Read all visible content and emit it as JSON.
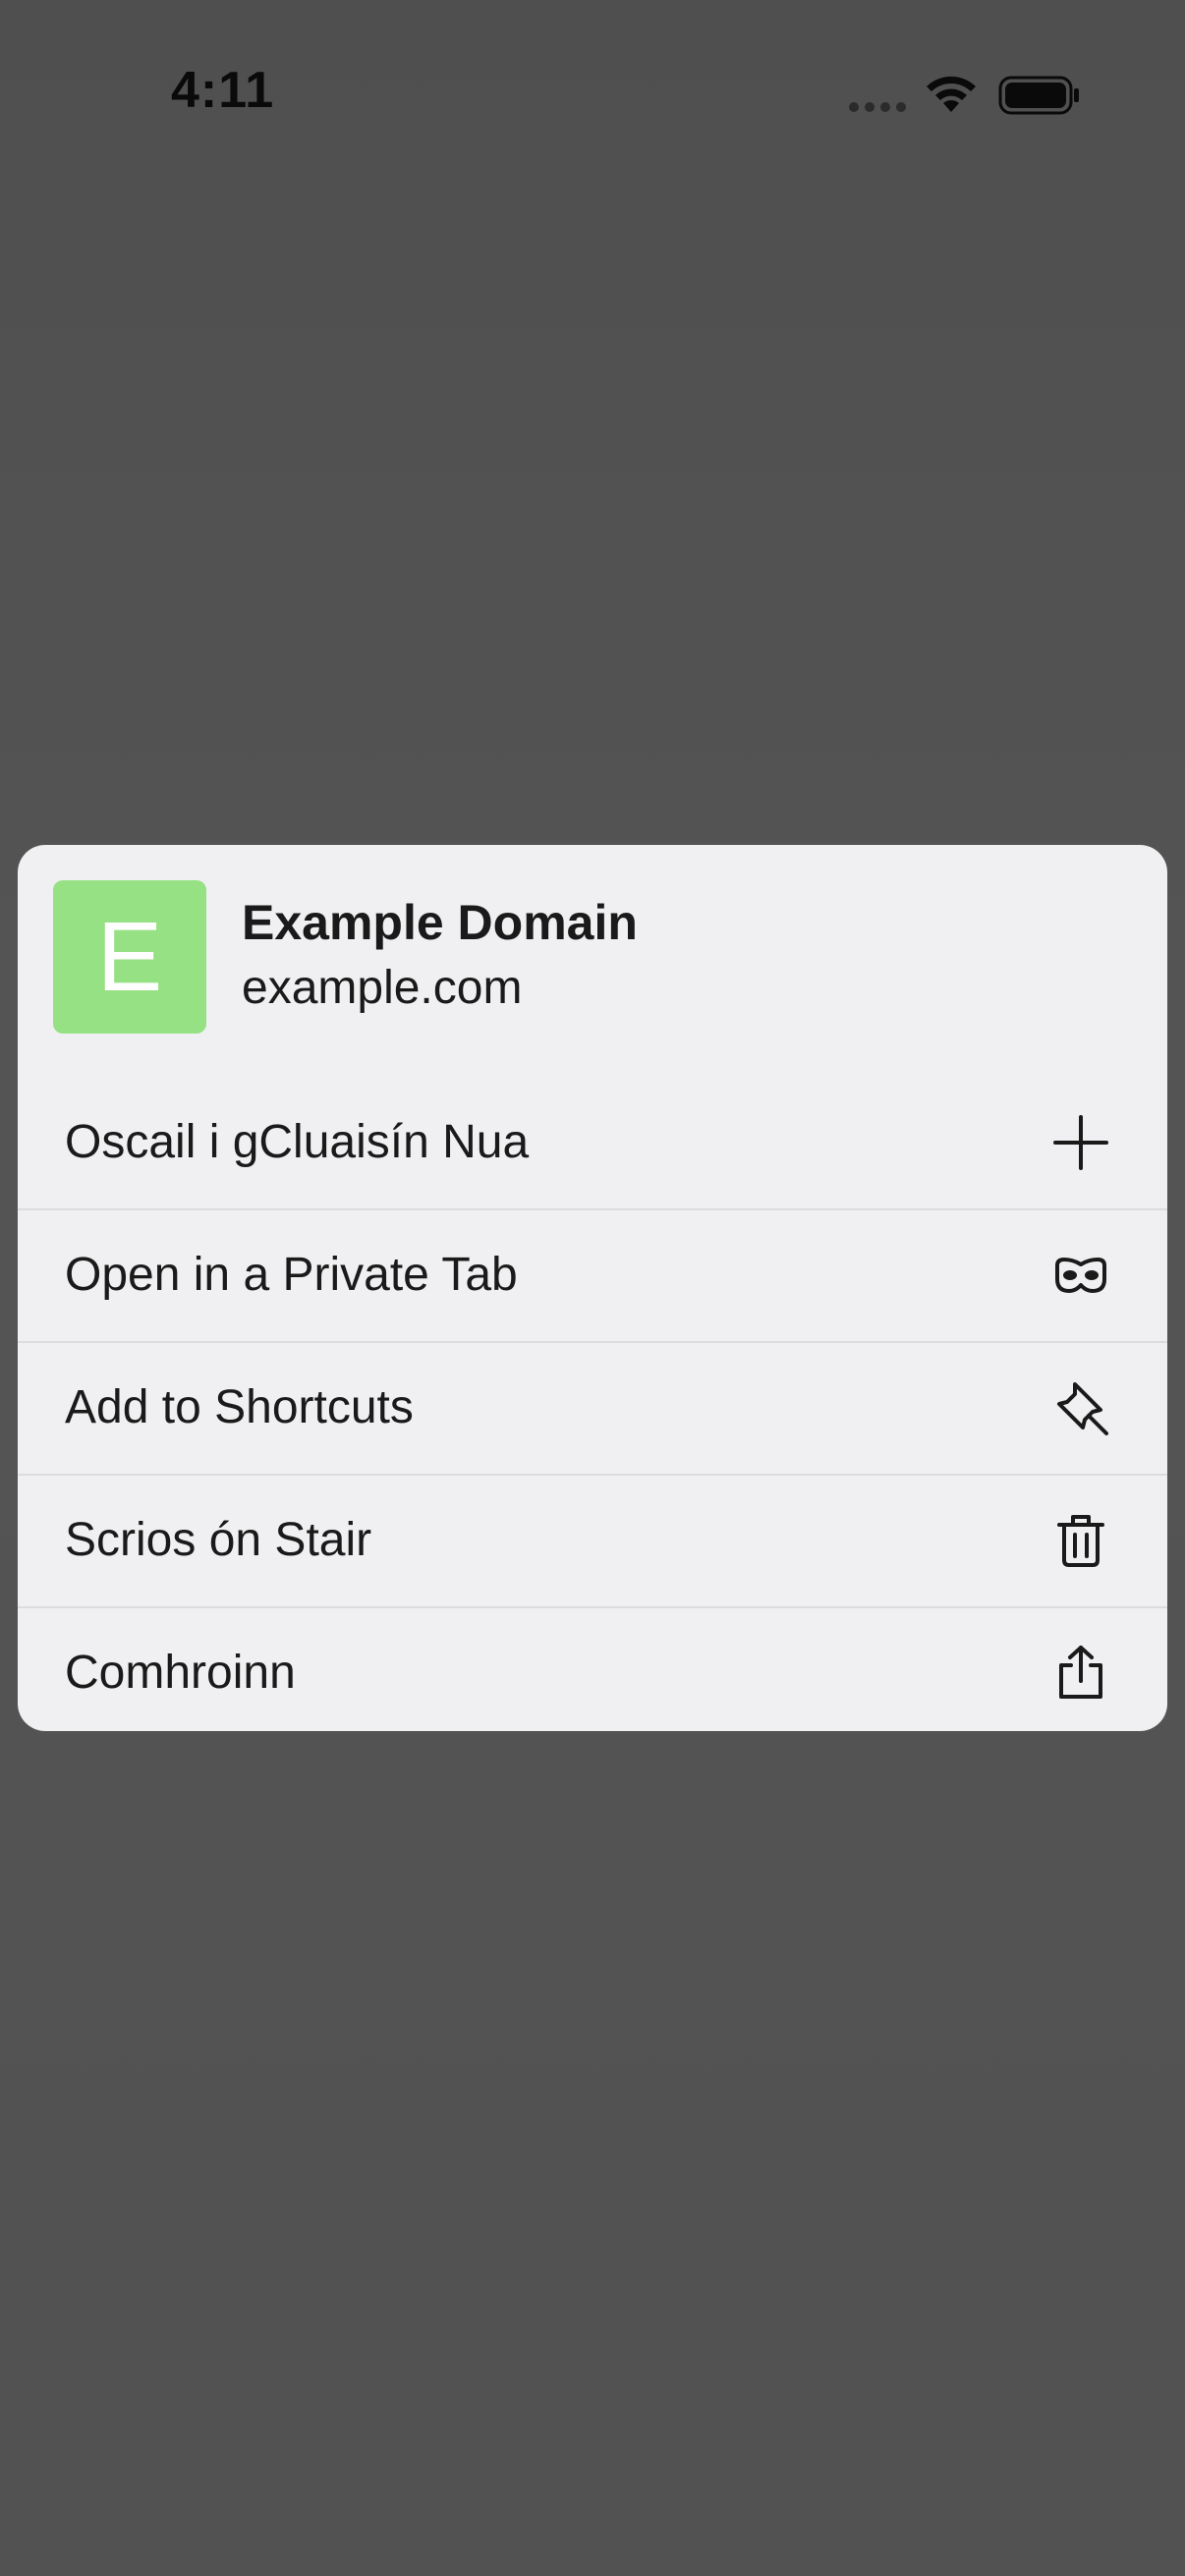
{
  "status_bar": {
    "time": "4:11",
    "icons": [
      "signal-dots-icon",
      "wifi-icon",
      "battery-icon"
    ]
  },
  "preview": {
    "favicon_letter": "E",
    "favicon_color": "#96e184",
    "title": "Example Domain",
    "url": "example.com"
  },
  "menu": {
    "items": [
      {
        "label": "Oscail i gCluaisín Nua",
        "icon": "plus-icon"
      },
      {
        "label": "Open in a Private Tab",
        "icon": "private-mask-icon"
      },
      {
        "label": "Add to Shortcuts",
        "icon": "pin-icon"
      },
      {
        "label": "Scrios ón Stair",
        "icon": "trash-icon"
      },
      {
        "label": "Comhroinn",
        "icon": "share-icon"
      }
    ]
  },
  "colors": {
    "backdrop": "#545454",
    "menu_background": "#f0f0f2",
    "text": "#1a1a1a"
  }
}
